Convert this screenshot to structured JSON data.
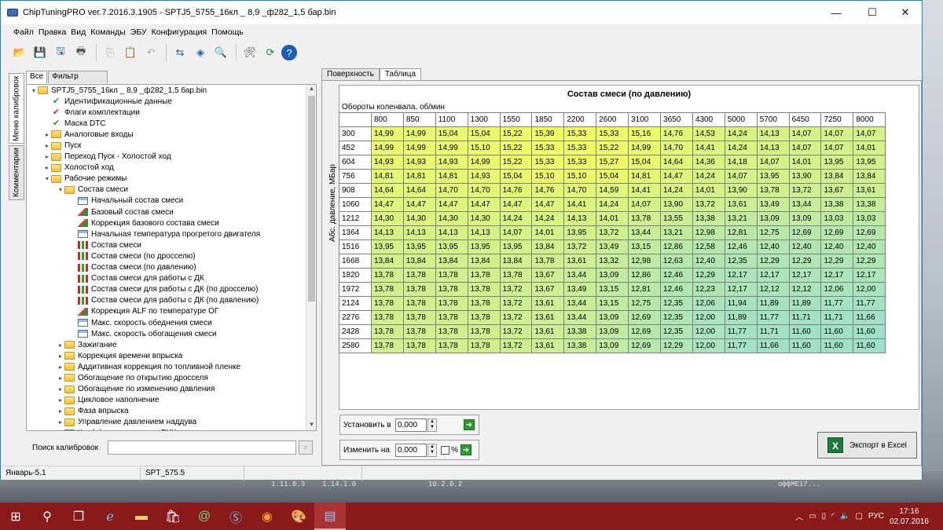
{
  "window": {
    "title": "ChipTuningPRO ver.7.2016.3.1905 - SPTJ5_5755_16кл _ 8,9 _ф282_1,5 бар.bin",
    "controls": [
      "—",
      "☐",
      "✕"
    ]
  },
  "menu": [
    "Файл",
    "Правка",
    "Вид",
    "Команды",
    "ЭБУ",
    "Конфигурация",
    "Помощь"
  ],
  "vertical_tabs": [
    "Меню калибровок",
    "Комментарии"
  ],
  "left_tabs": [
    "Все",
    "Фильтр"
  ],
  "tree": [
    {
      "level": 0,
      "arrow": "▾",
      "icon": "folder",
      "label": "SPTJ5_5755_16кл _ 8,9 _ф282_1,5 бар.bin"
    },
    {
      "level": 1,
      "arrow": "",
      "icon": "check",
      "label": "Идентификационные данные"
    },
    {
      "level": 1,
      "arrow": "",
      "icon": "check2",
      "label": "Флаги комплектации"
    },
    {
      "level": 1,
      "arrow": "",
      "icon": "check",
      "label": "Маска DTC"
    },
    {
      "level": 1,
      "arrow": "▸",
      "icon": "folder",
      "label": "Аналоговые входы"
    },
    {
      "level": 1,
      "arrow": "▸",
      "icon": "folder",
      "label": "Пуск"
    },
    {
      "level": 1,
      "arrow": "▸",
      "icon": "folder",
      "label": "Переход Пуск - Холостой ход"
    },
    {
      "level": 1,
      "arrow": "▸",
      "icon": "folder",
      "label": "Холостой ход"
    },
    {
      "level": 1,
      "arrow": "▾",
      "icon": "folder",
      "label": "Рабочие режимы"
    },
    {
      "level": 2,
      "arrow": "▾",
      "icon": "folder",
      "label": "Состав смеси"
    },
    {
      "level": 3,
      "arrow": "",
      "icon": "table",
      "label": "Начальный состав смеси"
    },
    {
      "level": 3,
      "arrow": "",
      "icon": "map3d",
      "label": "Базовый состав смеси"
    },
    {
      "level": 3,
      "arrow": "",
      "icon": "map3d",
      "label": "Коррекция базового состава смеси"
    },
    {
      "level": 3,
      "arrow": "",
      "icon": "table",
      "label": "Начальная температура прогретого двигателя"
    },
    {
      "level": 3,
      "arrow": "",
      "icon": "chart",
      "label": "Состав смеси"
    },
    {
      "level": 3,
      "arrow": "",
      "icon": "chart",
      "label": "Состав смеси (по дросселю)"
    },
    {
      "level": 3,
      "arrow": "",
      "icon": "chart",
      "label": "Состав смеси (по давлению)"
    },
    {
      "level": 3,
      "arrow": "",
      "icon": "chart",
      "label": "Состав смеси для работы с ДК"
    },
    {
      "level": 3,
      "arrow": "",
      "icon": "chart",
      "label": "Состав смеси для работы с ДК (по дросселю)"
    },
    {
      "level": 3,
      "arrow": "",
      "icon": "chart",
      "label": "Состав смеси для работы с ДК (по давлению)"
    },
    {
      "level": 3,
      "arrow": "",
      "icon": "map3d",
      "label": "Коррекция ALF по температуре ОГ"
    },
    {
      "level": 3,
      "arrow": "",
      "icon": "table",
      "label": "Макс. скорость обеднения смеси"
    },
    {
      "level": 3,
      "arrow": "",
      "icon": "table",
      "label": "Макс. скорость обогащения смеси"
    },
    {
      "level": 2,
      "arrow": "▸",
      "icon": "folder",
      "label": "Зажигание"
    },
    {
      "level": 2,
      "arrow": "▸",
      "icon": "folder",
      "label": "Коррекция времени впрыска"
    },
    {
      "level": 2,
      "arrow": "▸",
      "icon": "folder",
      "label": "Аддитивная коррекция по топливной пленке"
    },
    {
      "level": 2,
      "arrow": "▸",
      "icon": "folder",
      "label": "Обогащение по открытию дросселя"
    },
    {
      "level": 2,
      "arrow": "▸",
      "icon": "folder",
      "label": "Обогащение по изменению давления"
    },
    {
      "level": 2,
      "arrow": "▸",
      "icon": "folder",
      "label": "Цикловое наполнение"
    },
    {
      "level": 2,
      "arrow": "▸",
      "icon": "folder",
      "label": "Фаза впрыска"
    },
    {
      "level": 2,
      "arrow": "▸",
      "icon": "folder",
      "label": "Управление давлением наддува"
    },
    {
      "level": 2,
      "arrow": "",
      "icon": "table",
      "label": "Коэффициент уставки РХХ"
    }
  ],
  "search": {
    "label": "Поиск калибровок",
    "value": ""
  },
  "right_tabs": [
    "Поверхность",
    "Таблица"
  ],
  "map": {
    "title": "Состав смеси (по давлению)",
    "x_label": "Обороты коленвала, об/мин",
    "y_label": "Абс. давление, МБар",
    "cols": [
      "800",
      "850",
      "1100",
      "1300",
      "1550",
      "1850",
      "2200",
      "2600",
      "3100",
      "3650",
      "4300",
      "5000",
      "5700",
      "6450",
      "7250",
      "8000"
    ],
    "rows": [
      {
        "h": "300",
        "v": [
          "14,99",
          "14,99",
          "15,04",
          "15,04",
          "15,22",
          "15,39",
          "15,33",
          "15,33",
          "15,16",
          "14,76",
          "14,53",
          "14,24",
          "14,13",
          "14,07",
          "14,07",
          "14,07"
        ]
      },
      {
        "h": "452",
        "v": [
          "14,99",
          "14,99",
          "14,99",
          "15,10",
          "15,22",
          "15,33",
          "15,33",
          "15,22",
          "14,99",
          "14,70",
          "14,41",
          "14,24",
          "14,13",
          "14,07",
          "14,07",
          "14,01"
        ]
      },
      {
        "h": "604",
        "v": [
          "14,93",
          "14,93",
          "14,93",
          "14,99",
          "15,22",
          "15,33",
          "15,33",
          "15,27",
          "15,04",
          "14,64",
          "14,36",
          "14,18",
          "14,07",
          "14,01",
          "13,95",
          "13,95"
        ]
      },
      {
        "h": "756",
        "v": [
          "14,81",
          "14,81",
          "14,81",
          "14,93",
          "15,04",
          "15,10",
          "15,10",
          "15,04",
          "14,81",
          "14,47",
          "14,24",
          "14,07",
          "13,95",
          "13,90",
          "13,84",
          "13,84"
        ]
      },
      {
        "h": "908",
        "v": [
          "14,64",
          "14,64",
          "14,70",
          "14,70",
          "14,76",
          "14,76",
          "14,70",
          "14,59",
          "14,41",
          "14,24",
          "14,01",
          "13,90",
          "13,78",
          "13,72",
          "13,67",
          "13,61"
        ]
      },
      {
        "h": "1060",
        "v": [
          "14,47",
          "14,47",
          "14,47",
          "14,47",
          "14,47",
          "14,47",
          "14,41",
          "14,24",
          "14,07",
          "13,90",
          "13,72",
          "13,61",
          "13,49",
          "13,44",
          "13,38",
          "13,38"
        ]
      },
      {
        "h": "1212",
        "v": [
          "14,30",
          "14,30",
          "14,30",
          "14,30",
          "14,24",
          "14,24",
          "14,13",
          "14,01",
          "13,78",
          "13,55",
          "13,38",
          "13,21",
          "13,09",
          "13,09",
          "13,03",
          "13,03"
        ]
      },
      {
        "h": "1364",
        "v": [
          "14,13",
          "14,13",
          "14,13",
          "14,13",
          "14,07",
          "14,01",
          "13,95",
          "13,72",
          "13,44",
          "13,21",
          "12,98",
          "12,81",
          "12,75",
          "12,69",
          "12,69",
          "12,69"
        ]
      },
      {
        "h": "1516",
        "v": [
          "13,95",
          "13,95",
          "13,95",
          "13,95",
          "13,95",
          "13,84",
          "13,72",
          "13,49",
          "13,15",
          "12,86",
          "12,58",
          "12,46",
          "12,40",
          "12,40",
          "12,40",
          "12,40"
        ]
      },
      {
        "h": "1668",
        "v": [
          "13,84",
          "13,84",
          "13,84",
          "13,84",
          "13,84",
          "13,78",
          "13,61",
          "13,32",
          "12,98",
          "12,63",
          "12,40",
          "12,35",
          "12,29",
          "12,29",
          "12,29",
          "12,29"
        ]
      },
      {
        "h": "1820",
        "v": [
          "13,78",
          "13,78",
          "13,78",
          "13,78",
          "13,78",
          "13,67",
          "13,44",
          "13,09",
          "12,86",
          "12,46",
          "12,29",
          "12,17",
          "12,17",
          "12,17",
          "12,17",
          "12,17"
        ]
      },
      {
        "h": "1972",
        "v": [
          "13,78",
          "13,78",
          "13,78",
          "13,78",
          "13,72",
          "13,67",
          "13,49",
          "13,15",
          "12,81",
          "12,46",
          "12,23",
          "12,17",
          "12,12",
          "12,12",
          "12,06",
          "12,00"
        ]
      },
      {
        "h": "2124",
        "v": [
          "13,78",
          "13,78",
          "13,78",
          "13,78",
          "13,72",
          "13,61",
          "13,44",
          "13,15",
          "12,75",
          "12,35",
          "12,06",
          "11,94",
          "11,89",
          "11,89",
          "11,77",
          "11,77"
        ]
      },
      {
        "h": "2276",
        "v": [
          "13,78",
          "13,78",
          "13,78",
          "13,78",
          "13,72",
          "13,61",
          "13,44",
          "13,09",
          "12,69",
          "12,35",
          "12,00",
          "11,89",
          "11,77",
          "11,71",
          "11,71",
          "11,66"
        ]
      },
      {
        "h": "2428",
        "v": [
          "13,78",
          "13,78",
          "13,78",
          "13,78",
          "13,72",
          "13,61",
          "13,38",
          "13,09",
          "12,69",
          "12,35",
          "12,00",
          "11,77",
          "11,71",
          "11,60",
          "11,60",
          "11,60"
        ]
      },
      {
        "h": "2580",
        "v": [
          "13,78",
          "13,78",
          "13,78",
          "13,78",
          "13,72",
          "13,61",
          "13,38",
          "13,09",
          "12,69",
          "12,29",
          "12,00",
          "11,77",
          "11,66",
          "11,60",
          "11,60",
          "11,60"
        ]
      }
    ],
    "color_low": "#9fe1c8",
    "color_high": "#f2fb62"
  },
  "controls": {
    "set_label": "Установить в",
    "set_value": "0,000",
    "change_label": "Изменить на",
    "change_value": "0,000",
    "percent": "%",
    "export_label": "Экспорт в Excel"
  },
  "status": {
    "left": "Январь-5.1",
    "mid": "SPT_575.5"
  },
  "desktop_labels": [
    "1.11.0.3",
    "1.14.1.0",
    "10.2.0.2",
    "оффME17..."
  ],
  "tray": {
    "lang": "РУС",
    "time": "17:16",
    "date": "02.07.2016"
  }
}
